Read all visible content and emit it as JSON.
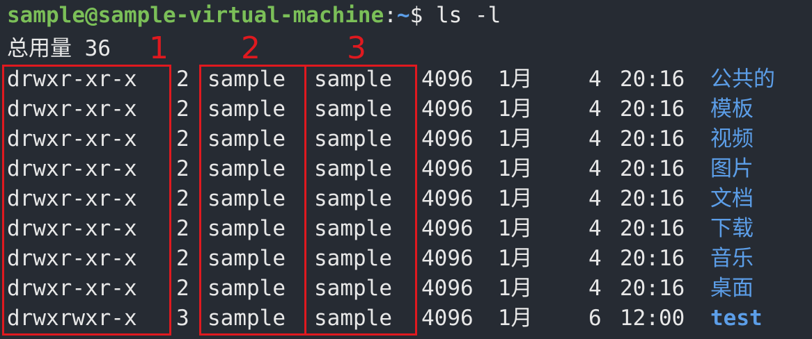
{
  "prompt": {
    "user_host": "sample@sample-virtual-machine",
    "separator": ":",
    "path": "~",
    "symbol": "$",
    "command": "ls -l"
  },
  "total": {
    "label": "总用量",
    "value": "36"
  },
  "annotations": {
    "color": "#e0191f",
    "labels": [
      "1",
      "2",
      "3"
    ]
  },
  "colors": {
    "background": "#262b33",
    "text": "#e8e8e8",
    "prompt_user": "#7bbf58",
    "directory": "#5c9ee8"
  },
  "listing": [
    {
      "perm": "drwxr-xr-x",
      "links": "2",
      "owner": "sample",
      "group": "sample",
      "size": "4096",
      "month": "1月",
      "day": "4",
      "time": "20:16",
      "name": "公共的"
    },
    {
      "perm": "drwxr-xr-x",
      "links": "2",
      "owner": "sample",
      "group": "sample",
      "size": "4096",
      "month": "1月",
      "day": "4",
      "time": "20:16",
      "name": "模板"
    },
    {
      "perm": "drwxr-xr-x",
      "links": "2",
      "owner": "sample",
      "group": "sample",
      "size": "4096",
      "month": "1月",
      "day": "4",
      "time": "20:16",
      "name": "视频"
    },
    {
      "perm": "drwxr-xr-x",
      "links": "2",
      "owner": "sample",
      "group": "sample",
      "size": "4096",
      "month": "1月",
      "day": "4",
      "time": "20:16",
      "name": "图片"
    },
    {
      "perm": "drwxr-xr-x",
      "links": "2",
      "owner": "sample",
      "group": "sample",
      "size": "4096",
      "month": "1月",
      "day": "4",
      "time": "20:16",
      "name": "文档"
    },
    {
      "perm": "drwxr-xr-x",
      "links": "2",
      "owner": "sample",
      "group": "sample",
      "size": "4096",
      "month": "1月",
      "day": "4",
      "time": "20:16",
      "name": "下载"
    },
    {
      "perm": "drwxr-xr-x",
      "links": "2",
      "owner": "sample",
      "group": "sample",
      "size": "4096",
      "month": "1月",
      "day": "4",
      "time": "20:16",
      "name": "音乐"
    },
    {
      "perm": "drwxr-xr-x",
      "links": "2",
      "owner": "sample",
      "group": "sample",
      "size": "4096",
      "month": "1月",
      "day": "4",
      "time": "20:16",
      "name": "桌面"
    },
    {
      "perm": "drwxrwxr-x",
      "links": "3",
      "owner": "sample",
      "group": "sample",
      "size": "4096",
      "month": "1月",
      "day": "6",
      "time": "12:00",
      "name": "test"
    }
  ]
}
